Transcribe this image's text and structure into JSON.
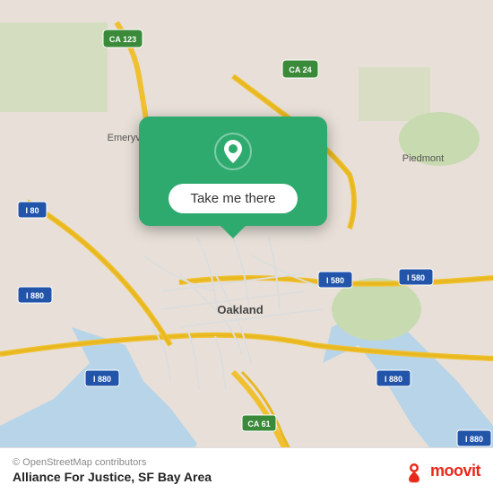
{
  "map": {
    "bg_color": "#e8e0d8",
    "road_color": "#f5c842",
    "highway_color": "#f5c842",
    "water_color": "#a8c8e8",
    "green_color": "#c8dab0"
  },
  "popup": {
    "bg_color": "#2eaa6e",
    "button_label": "Take me there",
    "pin_color": "white"
  },
  "bottom_bar": {
    "copyright": "© OpenStreetMap contributors",
    "location_title": "Alliance For Justice, SF Bay Area",
    "moovit_label": "moovit"
  }
}
